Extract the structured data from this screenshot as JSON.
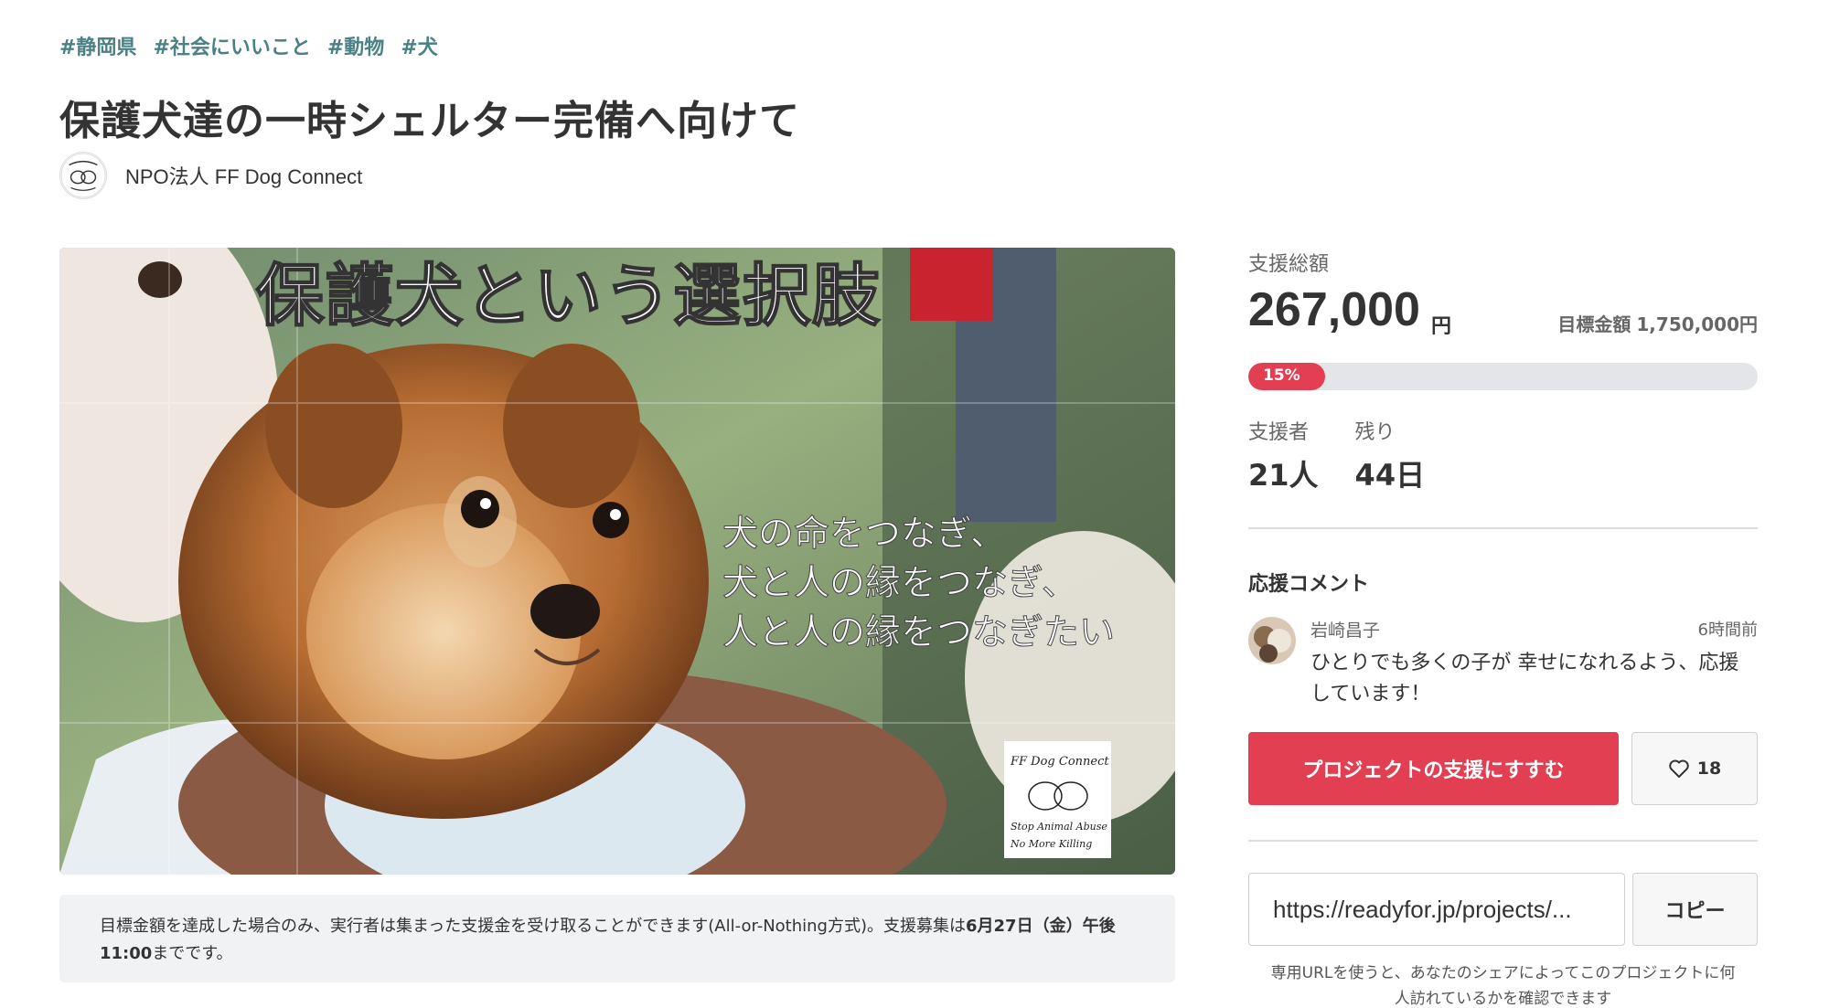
{
  "tags": [
    "#静岡県",
    "#社会にいいこと",
    "#動物",
    "#犬"
  ],
  "project": {
    "title": "保護犬達の一時シェルター完備へ向けて",
    "owner": "NPO法人 FF Dog Connect"
  },
  "hero": {
    "headline": "保護犬という選択肢",
    "lines": [
      "犬の命をつなぎ、",
      "犬と人の縁をつなぎ、",
      "人と人の縁をつなぎたい"
    ],
    "badge_lines": [
      "FF Dog Connect",
      "Stop Animal Abuse",
      "No More Killing"
    ]
  },
  "notice": {
    "text_before": "目標金額を達成した場合のみ、実行者は集まった支援金を受け取ることができます(All-or-Nothing方式)。支援募集は",
    "deadline": "6月27日（金）午後11:00",
    "text_after": "までです。"
  },
  "funding": {
    "total_label": "支援総額",
    "total_amount": "267,000",
    "currency": "円",
    "goal_label": "目標金額",
    "goal_amount": "1,750,000円",
    "progress_label": "15%",
    "progress_value": 0.15,
    "supporters_label": "支援者",
    "supporters_value": "21人",
    "remaining_label": "残り",
    "remaining_value": "44日"
  },
  "comments": {
    "title": "応援コメント",
    "items": [
      {
        "name": "岩崎昌子",
        "time": "6時間前",
        "text": "ひとりでも多くの子が 幸せになれるよう、応援しています！"
      }
    ]
  },
  "actions": {
    "support_label": "プロジェクトの支援にすすむ",
    "favorite_count": "18"
  },
  "share": {
    "url_value": "https://readyfor.jp/projects/...",
    "copy_label": "コピー",
    "note": "専用URLを使うと、あなたのシェアによってこのプロジェクトに何人訪れているかを確認できます"
  },
  "colors": {
    "tag": "#4a8184",
    "accent": "#e33f53",
    "progress_track": "#e3e5e8"
  },
  "icons": [
    "heart-icon"
  ]
}
